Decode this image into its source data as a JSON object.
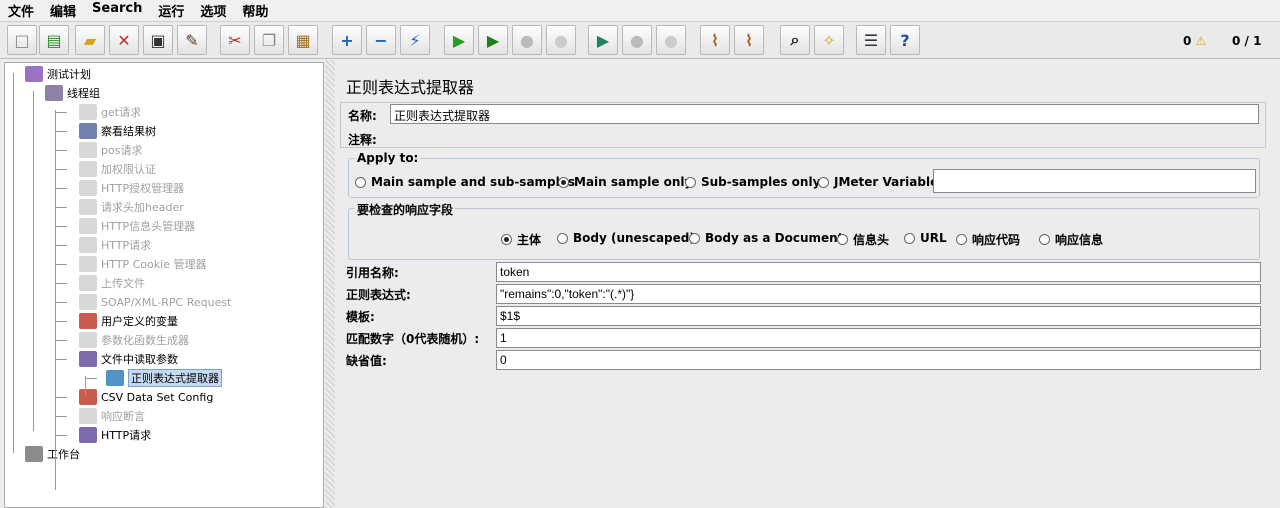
{
  "menu": [
    "文件",
    "编辑",
    "Search",
    "运行",
    "选项",
    "帮助"
  ],
  "toolbar": [
    {
      "name": "new",
      "g": "□",
      "c": "#888"
    },
    {
      "name": "templates",
      "g": "▤",
      "c": "#2a8a2a"
    },
    {
      "name": "open",
      "g": "▰",
      "c": "#d8a020"
    },
    {
      "name": "close",
      "g": "✕",
      "c": "#c03030"
    },
    {
      "name": "save",
      "g": "▣",
      "c": "#333"
    },
    {
      "name": "save-as",
      "g": "✎",
      "c": "#604020"
    },
    {
      "name": "cut",
      "g": "✂",
      "c": "#c02020"
    },
    {
      "name": "copy",
      "g": "❐",
      "c": "#888"
    },
    {
      "name": "paste",
      "g": "▦",
      "c": "#a07020"
    },
    {
      "name": "expand",
      "g": "+",
      "c": "#2060c0"
    },
    {
      "name": "collapse",
      "g": "−",
      "c": "#2060c0"
    },
    {
      "name": "toggle",
      "g": "⚡",
      "c": "#2060c0"
    },
    {
      "name": "start",
      "g": "▶",
      "c": "#20a020"
    },
    {
      "name": "start-no-pause",
      "g": "▶",
      "c": "#208020"
    },
    {
      "name": "stop",
      "g": "●",
      "c": "#bbb"
    },
    {
      "name": "shutdown",
      "g": "●",
      "c": "#ccc"
    },
    {
      "name": "remote-start",
      "g": "▶",
      "c": "#208060"
    },
    {
      "name": "remote-stop",
      "g": "●",
      "c": "#bbb"
    },
    {
      "name": "remote-shutdown",
      "g": "●",
      "c": "#ccc"
    },
    {
      "name": "clear",
      "g": "⌇",
      "c": "#a06020"
    },
    {
      "name": "clear-all",
      "g": "⌇",
      "c": "#a06020"
    },
    {
      "name": "search",
      "g": "⌕",
      "c": "#222"
    },
    {
      "name": "reset-search",
      "g": "✧",
      "c": "#d0a020"
    },
    {
      "name": "function-helper",
      "g": "☰",
      "c": "#334"
    },
    {
      "name": "help",
      "g": "?",
      "c": "#2050a0"
    }
  ],
  "status": {
    "warnings": "0",
    "threads": "0 / 1"
  },
  "tree": [
    {
      "label": "测试计划",
      "lvl": 0,
      "color": "#8a5ab8"
    },
    {
      "label": "线程组",
      "lvl": 1,
      "color": "#7a6a9a"
    },
    {
      "label": "get请求",
      "lvl": 2,
      "dis": true
    },
    {
      "label": "察看结果树",
      "lvl": 2,
      "color": "#5a6aa0"
    },
    {
      "label": "pos请求",
      "lvl": 2,
      "dis": true
    },
    {
      "label": "加权限认证",
      "lvl": 2,
      "dis": true
    },
    {
      "label": "HTTP授权管理器",
      "lvl": 2,
      "dis": true
    },
    {
      "label": "请求头加header",
      "lvl": 2,
      "dis": true
    },
    {
      "label": "HTTP信息头管理器",
      "lvl": 2,
      "dis": true
    },
    {
      "label": "HTTP请求",
      "lvl": 2,
      "dis": true
    },
    {
      "label": "HTTP Cookie 管理器",
      "lvl": 2,
      "dis": true
    },
    {
      "label": "上传文件",
      "lvl": 2,
      "dis": true
    },
    {
      "label": "SOAP/XML-RPC Request",
      "lvl": 2,
      "dis": true
    },
    {
      "label": "用户定义的变量",
      "lvl": 2,
      "color": "#c04030"
    },
    {
      "label": "参数化函数生成器",
      "lvl": 2,
      "dis": true
    },
    {
      "label": "文件中读取参数",
      "lvl": 2,
      "color": "#6a50a0"
    },
    {
      "label": "正则表达式提取器",
      "lvl": 3,
      "sel": true,
      "color": "#3080c0"
    },
    {
      "label": "CSV Data Set Config",
      "lvl": 2,
      "color": "#c04030"
    },
    {
      "label": "响应断言",
      "lvl": 2,
      "dis": true
    },
    {
      "label": "HTTP请求",
      "lvl": 2,
      "color": "#6a50a0"
    },
    {
      "label": "工作台",
      "lvl": 0,
      "color": "#777"
    }
  ],
  "panel": {
    "title": "正则表达式提取器",
    "name_label": "名称:",
    "name_value": "正则表达式提取器",
    "comment_label": "注释:",
    "comment_value": "",
    "apply_to": {
      "title": "Apply to:",
      "options": [
        "Main sample and sub-samples",
        "Main sample only",
        "Sub-samples only",
        "JMeter Variable"
      ],
      "selected": 1,
      "variable_value": ""
    },
    "field": {
      "title": "要检查的响应字段",
      "options": [
        "主体",
        "Body (unescaped)",
        "Body as a Document",
        "信息头",
        "URL",
        "响应代码",
        "响应信息"
      ],
      "selected": 0
    },
    "fields": [
      {
        "label": "引用名称:",
        "value": "token"
      },
      {
        "label": "正则表达式:",
        "value": "\"remains\":0,\"token\":\"(.*)\"}"
      },
      {
        "label": "模板:",
        "value": "$1$"
      },
      {
        "label": "匹配数字（0代表随机）:",
        "value": "1"
      },
      {
        "label": "缺省值:",
        "value": "0"
      }
    ]
  }
}
